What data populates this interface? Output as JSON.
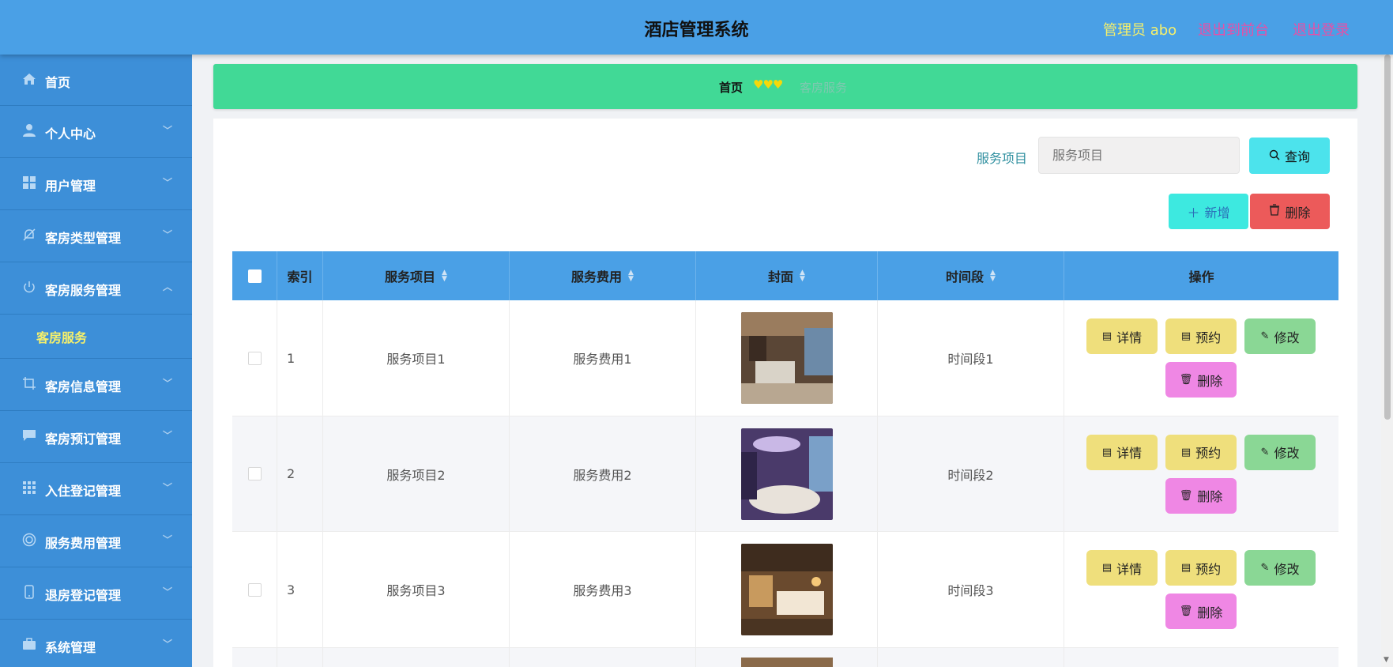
{
  "header": {
    "title": "酒店管理系统",
    "user": "管理员 abo",
    "front_link": "退出到前台",
    "logout_link": "退出登录"
  },
  "sidebar": {
    "items": [
      {
        "label": "首页",
        "icon": "home-icon"
      },
      {
        "label": "个人中心",
        "icon": "user-icon"
      },
      {
        "label": "用户管理",
        "icon": "grid-icon"
      },
      {
        "label": "客房类型管理",
        "icon": "bell-off-icon"
      },
      {
        "label": "客房服务管理",
        "icon": "power-icon"
      },
      {
        "label": "客房信息管理",
        "icon": "crop-icon"
      },
      {
        "label": "客房预订管理",
        "icon": "chat-icon"
      },
      {
        "label": "入住登记管理",
        "icon": "apps-icon"
      },
      {
        "label": "服务费用管理",
        "icon": "target-icon"
      },
      {
        "label": "退房登记管理",
        "icon": "phone-icon"
      },
      {
        "label": "系统管理",
        "icon": "briefcase-icon"
      }
    ],
    "active_sub": "客房服务"
  },
  "breadcrumb": {
    "home": "首页",
    "separator": "♥♥♥",
    "current": "客房服务"
  },
  "search": {
    "label": "服务项目",
    "placeholder": "服务项目",
    "query_button": "查询"
  },
  "actions": {
    "add": "新增",
    "delete": "删除"
  },
  "table": {
    "columns": [
      "索引",
      "服务项目",
      "服务费用",
      "封面",
      "时间段",
      "操作"
    ],
    "rows": [
      {
        "index": "1",
        "item": "服务项目1",
        "fee": "服务费用1",
        "period": "时间段1"
      },
      {
        "index": "2",
        "item": "服务项目2",
        "fee": "服务费用2",
        "period": "时间段2"
      },
      {
        "index": "3",
        "item": "服务项目3",
        "fee": "服务费用3",
        "period": "时间段3"
      }
    ],
    "row_buttons": {
      "detail": "详情",
      "book": "预约",
      "edit": "修改",
      "remove": "删除"
    }
  },
  "colors": {
    "header": "#4aa0e6",
    "sidebar": "#3d8fd8",
    "breadcrumb": "#41d996",
    "accent_yellow": "#f6f06a",
    "link_pink": "#e84fa6"
  }
}
